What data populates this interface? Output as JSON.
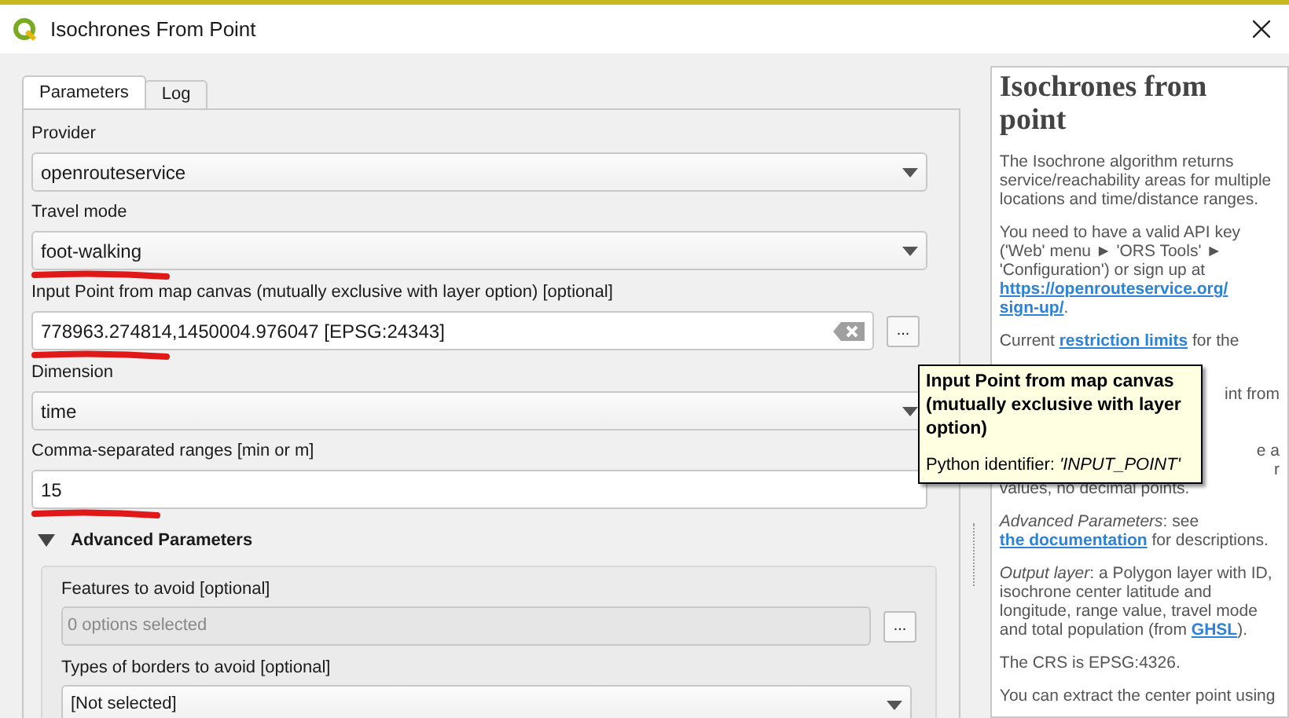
{
  "window": {
    "title": "Isochrones From Point"
  },
  "tabs": [
    {
      "label": "Parameters",
      "selected": true
    },
    {
      "label": "Log",
      "selected": false
    }
  ],
  "fields": [
    {
      "kind": "combo",
      "label": "Provider",
      "value": "openrouteservice",
      "underlined": false
    },
    {
      "kind": "combo",
      "label": "Travel mode",
      "value": "foot-walking",
      "underlined": true
    },
    {
      "kind": "point",
      "label": "Input Point from map canvas (mutually exclusive with layer option) [optional]",
      "value": "778963.274814,1450004.976047 [EPSG:24343]",
      "button": "...",
      "underlined": true
    },
    {
      "kind": "combo",
      "label": "Dimension",
      "value": "time",
      "underlined": false
    },
    {
      "kind": "text",
      "label": "Comma-separated ranges [min or m]",
      "value": "15",
      "underlined": true
    }
  ],
  "advanced": {
    "title": "Advanced Parameters",
    "expanded": true,
    "fields": [
      {
        "kind": "multi",
        "label": "Features to avoid [optional]",
        "placeholder": "0 options selected",
        "button": "..."
      },
      {
        "kind": "combo",
        "label": "Types of borders to avoid [optional]",
        "value": "[Not selected]"
      }
    ]
  },
  "tooltip": {
    "title": "Input Point from map canvas (mutually exclusive with layer option)",
    "identifier_label": "Python identifier: ",
    "identifier": "'INPUT_POINT'"
  },
  "help": {
    "title": "Isochrones from point",
    "paragraphs": [
      [
        {
          "kind": "text",
          "text": "The Isochrone algorithm returns service/reachability areas for multiple locations and time/distance ranges."
        }
      ],
      [
        {
          "kind": "text",
          "text": "You need to have a valid API key ('Web' menu ► 'ORS Tools' ► 'Configuration') or sign up at"
        },
        {
          "kind": "link",
          "text": "https://openrouteservice.org/"
        },
        {
          "kind": "link",
          "text": "sign-up/"
        },
        {
          "kind": "text",
          "text": "."
        }
      ],
      [
        {
          "kind": "text",
          "text": "Current"
        },
        {
          "kind": "link",
          "text": "restriction limits"
        },
        {
          "kind": "text",
          "text": "for the"
        }
      ]
    ],
    "fragments": [
      "int from",
      "e a",
      "r",
      "values, no decimal points."
    ],
    "paragraphs_after": [
      [
        {
          "kind": "italic",
          "text": "Advanced Parameters"
        },
        {
          "kind": "text",
          "text": ": see"
        },
        {
          "kind": "link",
          "text": "the documentation"
        },
        {
          "kind": "text",
          "text": "for descriptions."
        }
      ],
      [
        {
          "kind": "italic",
          "text": "Output layer"
        },
        {
          "kind": "text",
          "text": ": a Polygon layer with ID, isochrone center latitude and longitude, range value, travel mode and total population (from"
        },
        {
          "kind": "link",
          "text": "GHSL"
        },
        {
          "kind": "text",
          "text": ")."
        }
      ],
      [
        {
          "kind": "text",
          "text": "The CRS is EPSG:4326."
        }
      ],
      [
        {
          "kind": "text",
          "text": "You can extract the center point using"
        }
      ]
    ]
  }
}
